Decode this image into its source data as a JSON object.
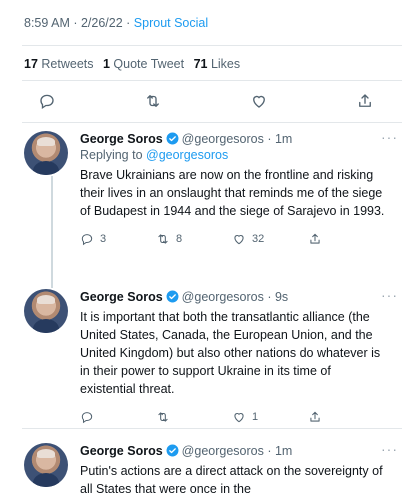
{
  "header": {
    "timestamp": "8:59 AM · 2/26/22 · ",
    "source": "Sprout Social"
  },
  "stats": {
    "retweets_count": "17",
    "retweets_label": "Retweets",
    "quote_count": "1",
    "quote_label": "Quote Tweet",
    "likes_count": "71",
    "likes_label": "Likes"
  },
  "main_actions": [
    "reply-icon",
    "retweet-icon",
    "like-icon",
    "share-icon"
  ],
  "tweets": [
    {
      "name": "George Soros",
      "handle": "@georgesoros · 1m",
      "replying_prefix": "Replying to ",
      "replying_handle": "@georgesoros",
      "text": "Brave Ukrainians are now on the frontline and risking their lives in an onslaught that reminds me of the siege of Budapest in 1944 and the siege of Sarajevo in 1993.",
      "replies": "3",
      "retweets": "8",
      "likes": "32",
      "more": "···"
    },
    {
      "name": "George Soros",
      "handle": "@georgesoros · 9s",
      "text": "It is important that both the transatlantic alliance (the United States, Canada, the European Union, and the United Kingdom) but also other nations do whatever is in their power to support Ukraine in its time of existential threat.",
      "replies": "",
      "retweets": "",
      "likes": "1",
      "more": "···"
    },
    {
      "name": "George Soros",
      "handle": "@georgesoros · 1m",
      "text": "Putin's actions are a direct attack on the sovereignty of all States that were once in the",
      "more": "···"
    }
  ],
  "colors": {
    "accent": "#1d9bf0",
    "secondary_text": "#536471",
    "divider": "#e3e7ea"
  }
}
